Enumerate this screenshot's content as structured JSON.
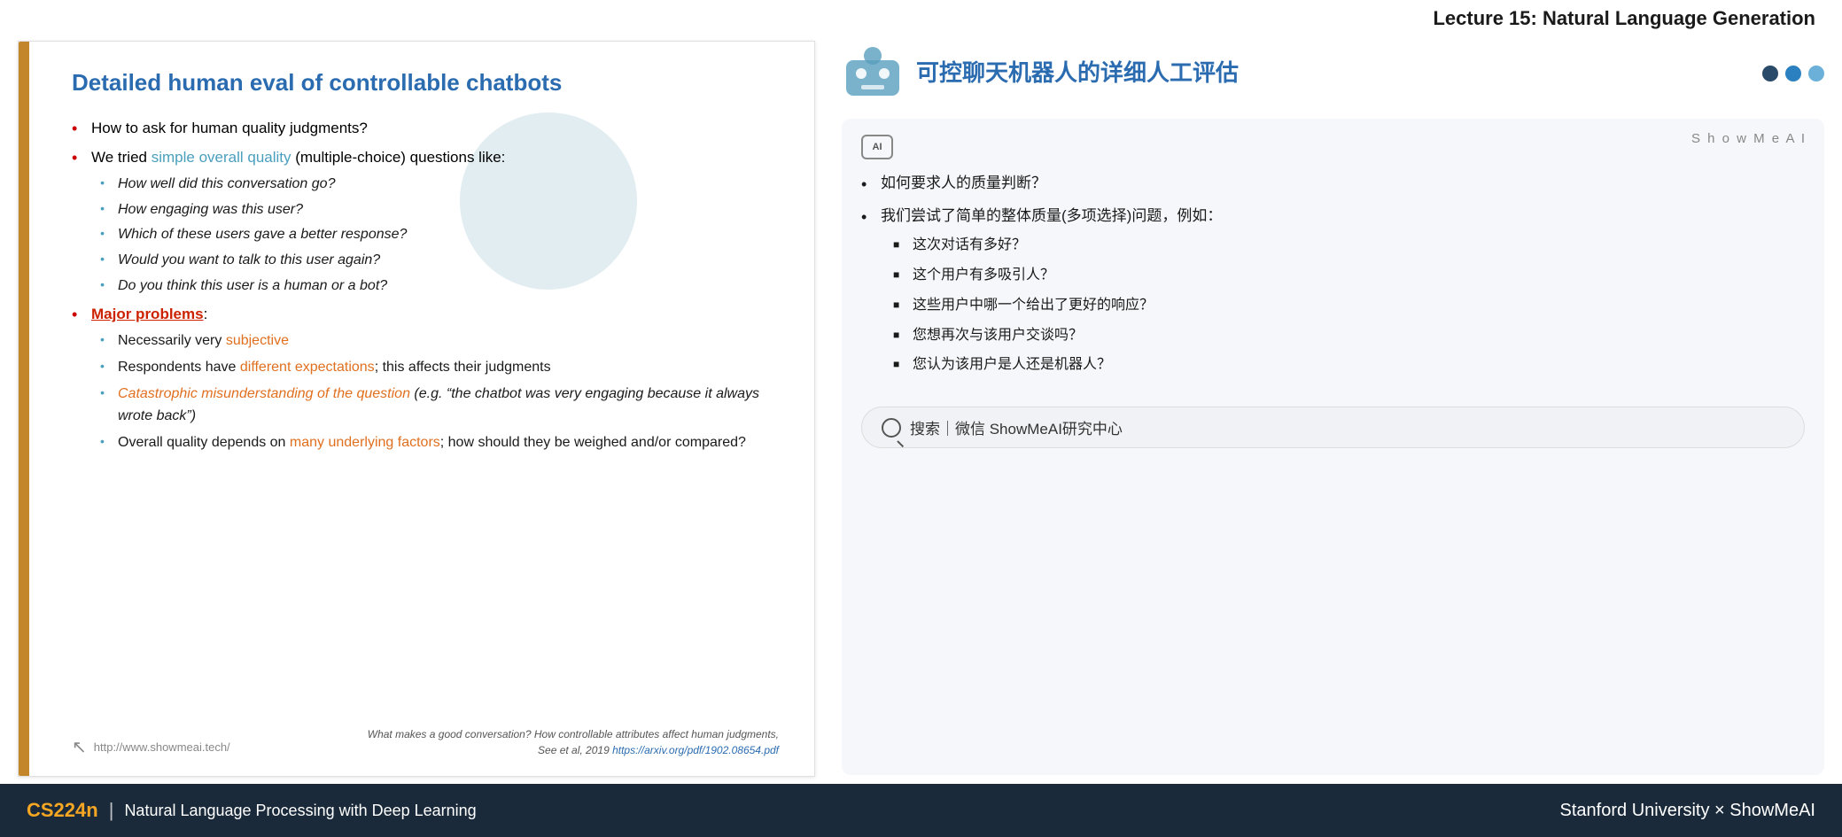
{
  "header": {
    "lecture_title": "Lecture 15: Natural Language Generation"
  },
  "left_slide": {
    "title": "Detailed human eval of controllable chatbots",
    "bullets": [
      {
        "text_prefix": "How to ask for human quality judgments?"
      },
      {
        "text_prefix": "We tried ",
        "highlighted": "simple overall quality",
        "text_suffix": " (multiple-choice) questions like:",
        "sub_items": [
          "How well did this conversation go?",
          "How engaging was this user?",
          "Which of these users gave a better response?",
          "Would you want to talk to this user again?",
          "Do you think this user is a human or a bot?"
        ]
      },
      {
        "bold_underline": "Major problems",
        "text_suffix": ":",
        "sub_items_styled": [
          {
            "prefix": "Necessarily very ",
            "color_word": "subjective",
            "suffix": ""
          },
          {
            "prefix": "Respondents have ",
            "color_word": "different expectations",
            "suffix": "; this affects their judgments"
          },
          {
            "prefix": "",
            "color_word": "Catastrophic misunderstanding of the question",
            "suffix": " (e.g. “the chatbot was very engaging because it always wrote back”)"
          },
          {
            "prefix": "Overall quality depends on ",
            "color_word": "many underlying factors",
            "suffix": "; how should they be weighed and/or compared?"
          }
        ]
      }
    ],
    "footer": {
      "cursor_icon": "↖",
      "url": "http://www.showmeai.tech/",
      "citation_italic": "What makes a good conversation? How controllable attributes affect human judgments,",
      "citation_ref": "See et al, 2019 https://arxiv.org/pdf/1902.08654.pdf",
      "citation_link": "https://arxiv.org/pdf/1902.08654.pdf"
    }
  },
  "right_panel": {
    "title": "可控聊天机器人的详细人工评估",
    "dots": [
      "dark",
      "blue",
      "light"
    ],
    "showmeai_badge": "S h o w M e A I",
    "ai_icon_label": "AI",
    "chat_bullets": [
      {
        "text": "如何要求人的质量判断？"
      },
      {
        "text_prefix": "我们尝试了简单的整体质量(多项选择)问题，例如：",
        "sub_items": [
          "这次对话有多好？",
          "这个用户有多吸引人？",
          "这些用户中哪一个给出了更好的响应？",
          "您想再次与该用户交谈吗？",
          "您认为该用户是人还是机器人？"
        ]
      }
    ],
    "search_bar": {
      "icon": "search",
      "divider": "｜",
      "text": "搜索｜微信 ShowMeAI研究中心"
    }
  },
  "bottom_bar": {
    "cs224n": "CS224n",
    "divider": "|",
    "subtitle": "Natural Language Processing with Deep Learning",
    "right_text": "Stanford University × ShowMeAI"
  }
}
